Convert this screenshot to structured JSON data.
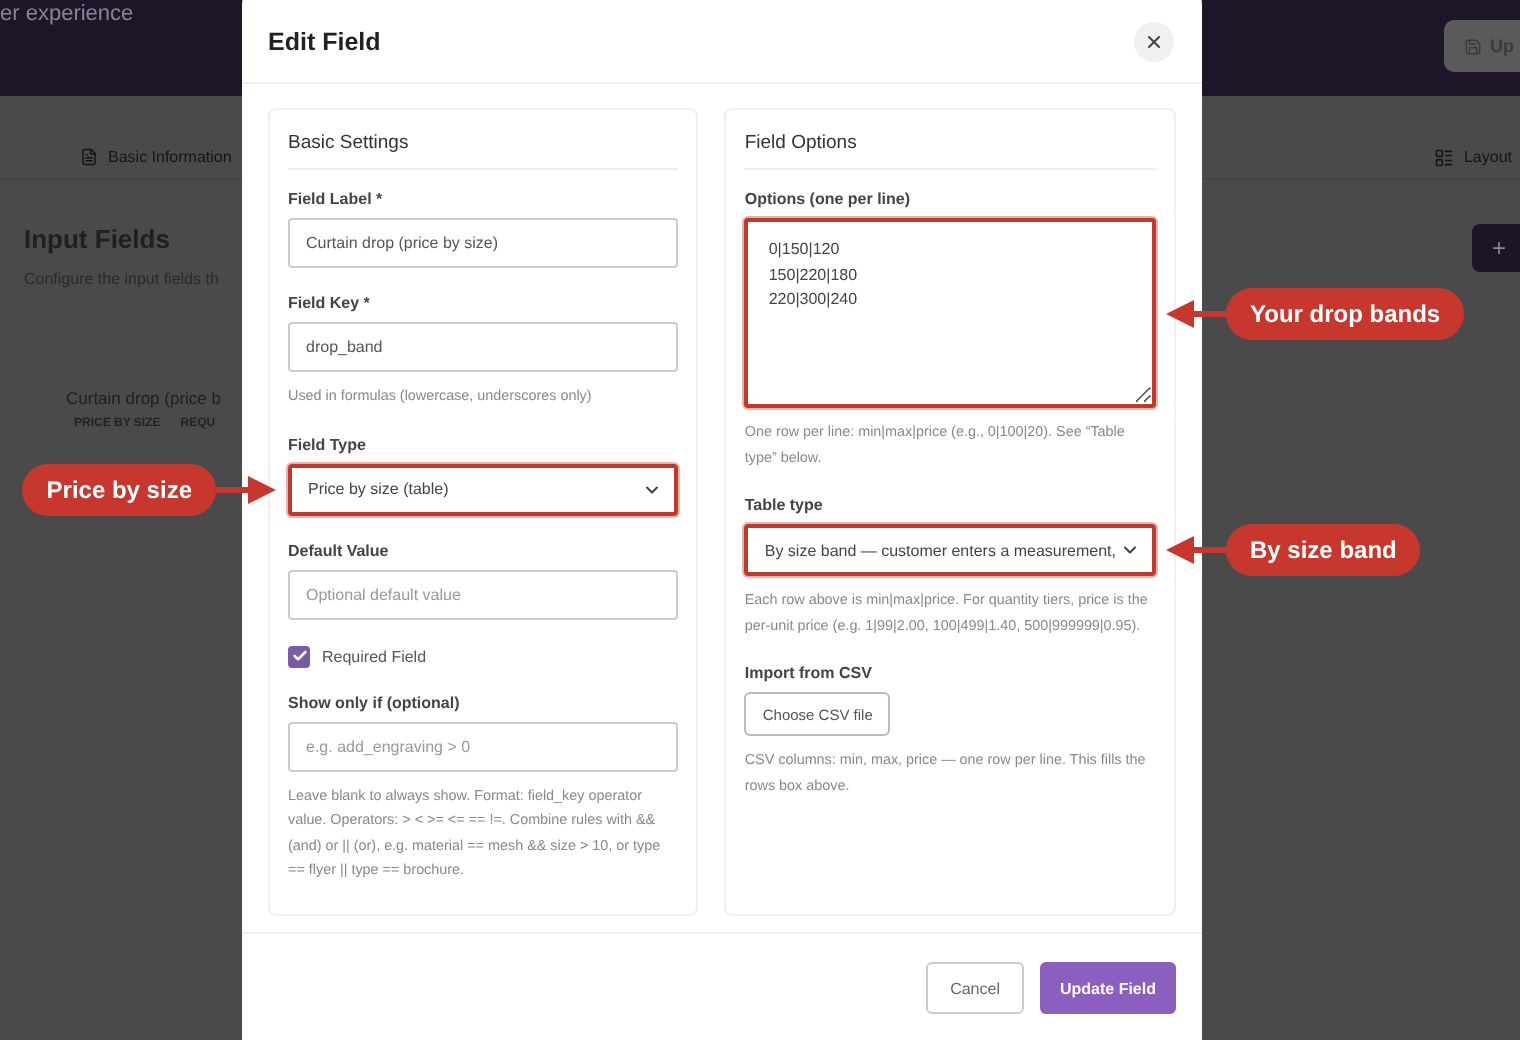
{
  "background": {
    "tagline": "er experience",
    "save_button": "Up",
    "tabs": [
      "Basic Information",
      "Layout"
    ],
    "heading": "Input Fields",
    "subtitle": "Configure the input fields th",
    "add_button": "+",
    "field_card": {
      "title": "Curtain drop (price b",
      "tags": [
        "PRICE BY SIZE",
        "REQU"
      ]
    }
  },
  "dialog": {
    "title": "Edit Field",
    "panels": [
      {
        "title": "Basic Settings",
        "fields": [
          {
            "kind": "text",
            "label": "Field Label *",
            "value": "Curtain drop (price by size)"
          },
          {
            "kind": "text",
            "label": "Field Key *",
            "value": "drop_band",
            "help": "Used in formulas (lowercase, underscores only)"
          },
          {
            "kind": "select",
            "label": "Field Type",
            "value": "Price by size (table)",
            "highlighted": true,
            "callout": "Price by size"
          },
          {
            "kind": "text",
            "label": "Default Value",
            "placeholder": "Optional default value"
          },
          {
            "kind": "checkbox",
            "label": "Required Field",
            "checked": true
          },
          {
            "kind": "text",
            "label": "Show only if (optional)",
            "placeholder": "e.g. add_engraving > 0",
            "help": "Leave blank to always show. Format: field_key operator value. Operators: > < >= <= == !=. Combine rules with && (and) or || (or), e.g. material == mesh && size > 10, or type == flyer || type == brochure."
          }
        ]
      },
      {
        "title": "Field Options",
        "fields": [
          {
            "kind": "textarea",
            "label": "Options (one per line)",
            "value": "0|150|120\n150|220|180\n220|300|240",
            "highlighted": true,
            "callout": "Your drop bands",
            "help": "One row per line: min|max|price (e.g., 0|100|20). See “Table type” below."
          },
          {
            "kind": "select",
            "label": "Table type",
            "value": "By size band — customer enters a measurement,",
            "highlighted": true,
            "callout": "By size band",
            "help": "Each row above is min|max|price. For quantity tiers, price is the per-unit price (e.g. 1|99|2.00, 100|499|1.40, 500|999999|0.95)."
          },
          {
            "kind": "file",
            "label": "Import from CSV",
            "button": "Choose CSV file",
            "help": "CSV columns: min, max, price — one row per line. This fills the rows box above."
          }
        ]
      }
    ],
    "buttons": [
      {
        "label": "Cancel",
        "kind": "secondary"
      },
      {
        "label": "Update Field",
        "kind": "primary"
      }
    ]
  }
}
